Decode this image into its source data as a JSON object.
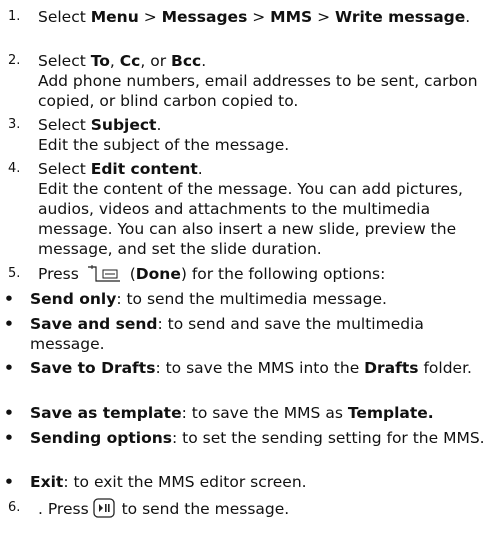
{
  "steps": [
    {
      "num": "1.",
      "pre": "Select ",
      "b1": "Menu",
      "m1": " > ",
      "b2": "Messages",
      "m2": " > ",
      "b3": "MMS",
      "m3": " > ",
      "b4": "Write message",
      "post": "."
    },
    {
      "num": "2.",
      "pre": "Select ",
      "b1": "To",
      "m1": ", ",
      "b2": "Cc",
      "m2": ", or ",
      "b3": "Bcc",
      "post": ".",
      "desc": "Add phone numbers, email addresses to be sent, carbon copied, or blind carbon copied to."
    },
    {
      "num": "3.",
      "pre": "Select ",
      "b1": "Subject",
      "post": ".",
      "desc": "Edit the subject of the message."
    },
    {
      "num": "4.",
      "pre": "Select ",
      "b1": "Edit content",
      "post": ".",
      "desc": "Edit the content of the message. You can add pictures, audios, videos and attachments to the multimedia message. You can also insert a new slide, preview the message, and set the slide duration."
    },
    {
      "num": "5.",
      "pre": "Press",
      "paren_open": " (",
      "b1": "Done",
      "post": ") for the following options:",
      "icon": "soft-key-icon"
    },
    {
      "num": "6.",
      "pre": ". Press",
      "post": " to send the message.",
      "icon": "ok-key-icon"
    }
  ],
  "options": [
    {
      "bold": "Send only",
      "text": ": to send the multimedia message."
    },
    {
      "bold": "Save and send",
      "text": ": to send and save the multimedia message."
    },
    {
      "bold": "Save to Drafts",
      "text": ": to save the MMS into the ",
      "bold2": "Drafts",
      "text2": " folder."
    },
    {
      "bold": "Save as template",
      "text": ": to save the MMS as ",
      "bold2": "Template."
    },
    {
      "bold": "Sending options",
      "text": ": to set the sending setting for the MMS."
    },
    {
      "bold": "Exit",
      "text": ": to exit the MMS editor screen."
    }
  ],
  "bullet_char": "•"
}
